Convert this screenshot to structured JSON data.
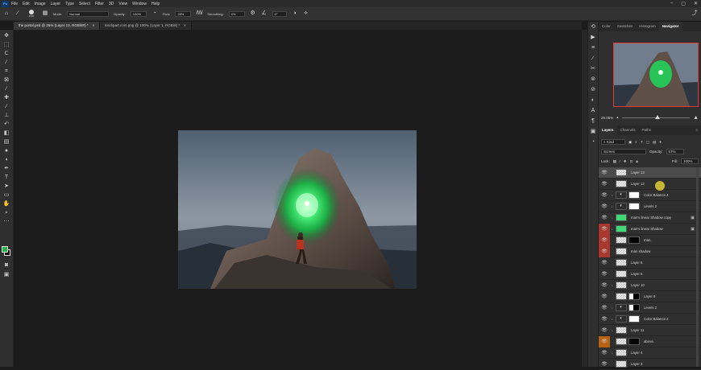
{
  "app": {
    "logo": "Ps"
  },
  "menu": [
    "File",
    "Edit",
    "Image",
    "Layer",
    "Type",
    "Select",
    "Filter",
    "3D",
    "View",
    "Window",
    "Help"
  ],
  "options": {
    "brush_size": "2500",
    "mode_label": "Mode:",
    "mode_value": "Normal",
    "opacity_label": "Opacity:",
    "opacity_value": "100%",
    "flow_label": "Flow:",
    "flow_value": "28%",
    "smoothing_label": "Smoothing:",
    "smoothing_value": "0%",
    "angle_value": "0°"
  },
  "tabs": [
    {
      "label": "the portal.psd @ 26% (Layer 13, RGB/8#) *",
      "active": true
    },
    {
      "label": "kisclipart.com.png @ 100% (Layer 1, RGB/8) *",
      "active": false
    }
  ],
  "tab_close": "×",
  "panel_top_tabs": [
    "Color",
    "Swatches",
    "Histogram",
    "Navigator"
  ],
  "navigator": {
    "zoom": "26.05%"
  },
  "layers_panel": {
    "tabs": [
      "Layers",
      "Channels",
      "Paths"
    ],
    "kind_filter": "Kind",
    "blend_mode": "Screen",
    "opacity_label": "Opacity:",
    "opacity_value": "57%",
    "lock_label": "Lock:",
    "fill_label": "Fill:",
    "fill_value": "100%"
  },
  "layers": [
    {
      "name": "Layer 13",
      "thumb": "checker",
      "selected": true,
      "eye": "plain"
    },
    {
      "name": "Layer 12",
      "thumb": "checker",
      "eye": "plain"
    },
    {
      "name": "Color Balance 4",
      "thumb": "adj",
      "mask": "white",
      "clip": true,
      "eye": "plain"
    },
    {
      "name": "Levels 2",
      "thumb": "adj",
      "mask": "white",
      "clip": true,
      "eye": "plain"
    },
    {
      "name": "man's linear Shadow copy",
      "thumb": "green",
      "clip": true,
      "fx": true,
      "eye": "plain"
    },
    {
      "name": "man's linear Shadow",
      "thumb": "green",
      "clip": true,
      "fx": true,
      "eye": "red"
    },
    {
      "name": "man.",
      "thumb": "checker",
      "mask": "black",
      "clip": false,
      "eye": "red"
    },
    {
      "name": "man shadow",
      "thumb": "checker",
      "eye": "red"
    },
    {
      "name": "Layer 6",
      "thumb": "checker",
      "eye": "plain"
    },
    {
      "name": "Layer 5",
      "thumb": "checker",
      "eye": "plain"
    },
    {
      "name": "Layer 10",
      "thumb": "checker",
      "clip": true,
      "eye": "plain"
    },
    {
      "name": "Layer 9",
      "thumb": "checker",
      "mask": "blackwhite",
      "eye": "plain"
    },
    {
      "name": "Levels 2",
      "thumb": "adj",
      "mask": "blackwhite",
      "clip": true,
      "eye": "plain"
    },
    {
      "name": "Color Balance 2",
      "thumb": "adj",
      "mask": "white",
      "clip": true,
      "eye": "plain"
    },
    {
      "name": "Layer 11",
      "thumb": "checker",
      "clip": true,
      "eye": "plain"
    },
    {
      "name": "above.",
      "thumb": "checker",
      "mask": "black",
      "eye": "orange"
    },
    {
      "name": "Layer 4",
      "thumb": "checker",
      "clip": true,
      "eye": "plain"
    },
    {
      "name": "Layer 3",
      "thumb": "checker",
      "eye": "plain"
    }
  ],
  "colors": {
    "foreground": "#27b34c",
    "background": "#000000",
    "accent_red": "#a8372e",
    "accent_orange": "#b86314"
  }
}
